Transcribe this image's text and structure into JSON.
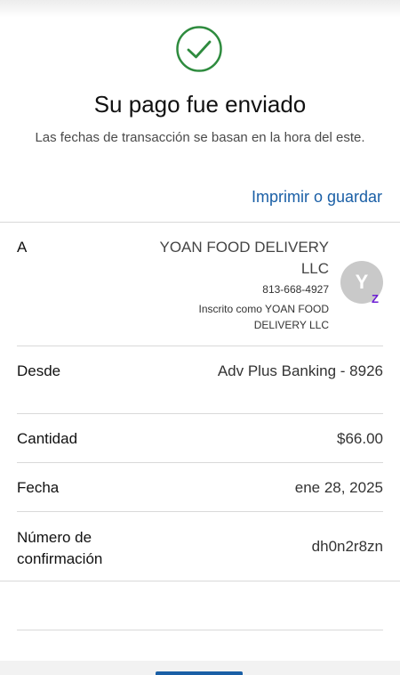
{
  "header": {
    "title": "Su pago fue enviado",
    "subtitle": "Las fechas de transacción se basan en la hora del este.",
    "print_link": "Imprimir o guardar"
  },
  "details": {
    "to": {
      "label": "A",
      "name": "YOAN FOOD DELIVERY LLC",
      "phone": "813-668-4927",
      "enrolled_as": "Inscrito como YOAN FOOD DELIVERY LLC",
      "avatar_initial": "Y",
      "badge": "Z"
    },
    "from": {
      "label": "Desde",
      "value": "Adv Plus Banking - 8926"
    },
    "amount": {
      "label": "Cantidad",
      "value": "$66.00"
    },
    "date": {
      "label": "Fecha",
      "value": "ene 28, 2025"
    },
    "confirmation": {
      "label": "Número de confirmación",
      "value": "dh0n2r8zn"
    }
  },
  "colors": {
    "success_green": "#2e8b3e",
    "link_blue": "#1a5fa6",
    "zelle_purple": "#6d1ed4"
  }
}
